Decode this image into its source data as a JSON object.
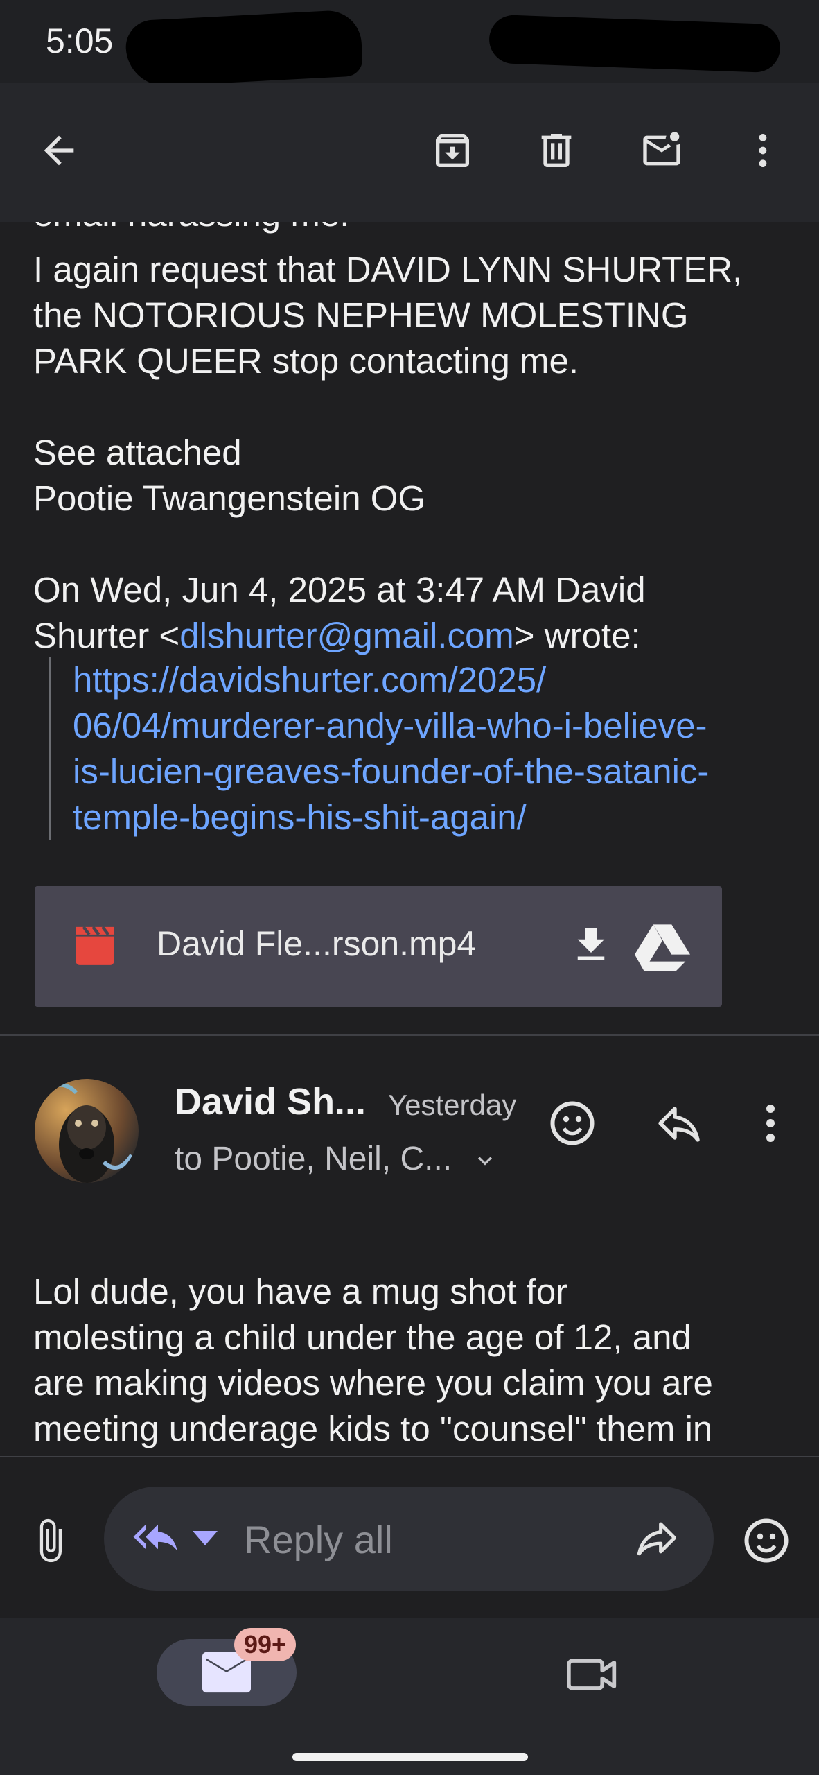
{
  "status_bar": {
    "time": "5:05"
  },
  "message": {
    "line_cut": "email harassing me.",
    "paragraph1": "I again request that DAVID LYNN SHURTER,\nthe NOTORIOUS NEPHEW MOLESTING\nPARK QUEER stop contacting me.",
    "see_attached": "See attached",
    "signature": "Pootie Twangenstein OG",
    "on_line_prefix": "On Wed, Jun 4, 2025 at 3:47 AM David\nShurter <",
    "on_line_email": "dlshurter@gmail.com",
    "on_line_suffix": "> wrote:",
    "quoted_link": "https://davidshurter.com/2025/\n06/04/murderer-andy-villa-who-i-believe-\nis-lucien-greaves-founder-of-the-satanic-\ntemple-begins-his-shit-again/",
    "attachment": {
      "name": "David Fle...rson.mp4",
      "icon": "video-clapper-icon"
    }
  },
  "reply": {
    "sender": "David Sh...",
    "timestamp": "Yesterday",
    "recipients": "to Pootie, Neil, C...",
    "body": "Lol dude, you have a mug shot for\nmolesting a child under the age of 12, and\nare making videos where you claim you are\nmeeting underage kids to \"counsel\" them in"
  },
  "compose": {
    "placeholder": "Reply all"
  },
  "nav": {
    "mail_badge": "99+"
  },
  "colors": {
    "link": "#6ea5ff",
    "accent": "#a8a6ff",
    "background": "#1f1f21"
  }
}
